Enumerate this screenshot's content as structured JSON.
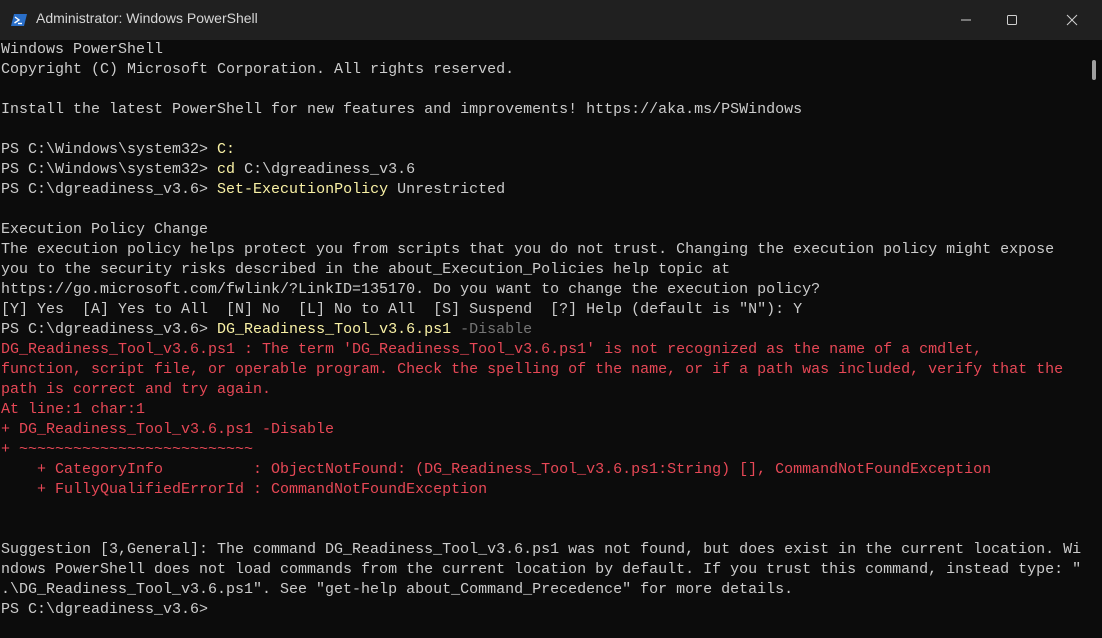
{
  "window": {
    "ghost_text": "                    ",
    "title": "Administrator: Windows PowerShell"
  },
  "console": {
    "lines": [
      "Windows PowerShell",
      "Copyright (C) Microsoft Corporation. All rights reserved.",
      "",
      "Install the latest PowerShell for new features and improvements! https://aka.ms/PSWindows",
      "",
      "PS C:\\Windows\\system32> ",
      "PS C:\\Windows\\system32> ",
      "PS C:\\dgreadiness_v3.6> ",
      "",
      "Execution Policy Change",
      "The execution policy helps protect you from scripts that you do not trust. Changing the execution policy might expose",
      "you to the security risks described in the about_Execution_Policies help topic at",
      "https://go.microsoft.com/fwlink/?LinkID=135170. Do you want to change the execution policy?",
      "[Y] Yes  [A] Yes to All  [N] No  [L] No to All  [S] Suspend  [?] Help (default is \"N\"): Y",
      "PS C:\\dgreadiness_v3.6> ",
      "DG_Readiness_Tool_v3.6.ps1 : The term 'DG_Readiness_Tool_v3.6.ps1' is not recognized as the name of a cmdlet,",
      "function, script file, or operable program. Check the spelling of the name, or if a path was included, verify that the",
      "path is correct and try again.",
      "At line:1 char:1",
      "+ DG_Readiness_Tool_v3.6.ps1 -Disable",
      "+ ~~~~~~~~~~~~~~~~~~~~~~~~~~",
      "    + CategoryInfo          : ObjectNotFound: (DG_Readiness_Tool_v3.6.ps1:String) [], CommandNotFoundException",
      "    + FullyQualifiedErrorId : CommandNotFoundException",
      "",
      "",
      "Suggestion [3,General]: The command DG_Readiness_Tool_v3.6.ps1 was not found, but does exist in the current location. Wi",
      "ndows PowerShell does not load commands from the current location by default. If you trust this command, instead type: \"",
      ".\\DG_Readiness_Tool_v3.6.ps1\". See \"get-help about_Command_Precedence\" for more details.",
      "PS C:\\dgreadiness_v3.6> "
    ],
    "commands": {
      "c": "C:",
      "cd_cmd": "cd ",
      "cd_arg": "C:\\dgreadiness_v3.6",
      "sep_cmd": "Set-ExecutionPolicy ",
      "sep_arg": "Unrestricted",
      "dg_cmd": "DG_Readiness_Tool_v3.6.ps1 ",
      "dg_param": "-Disable"
    }
  },
  "colors": {
    "background": "#0c0c0c",
    "text": "#cccccc",
    "error": "#e74856",
    "command": "#f9f1a5",
    "parameter": "#767676",
    "titlebar": "#202020"
  },
  "icons": {
    "app": "powershell-icon",
    "minimize": "minimize-icon",
    "maximize": "maximize-icon",
    "close": "close-icon"
  }
}
